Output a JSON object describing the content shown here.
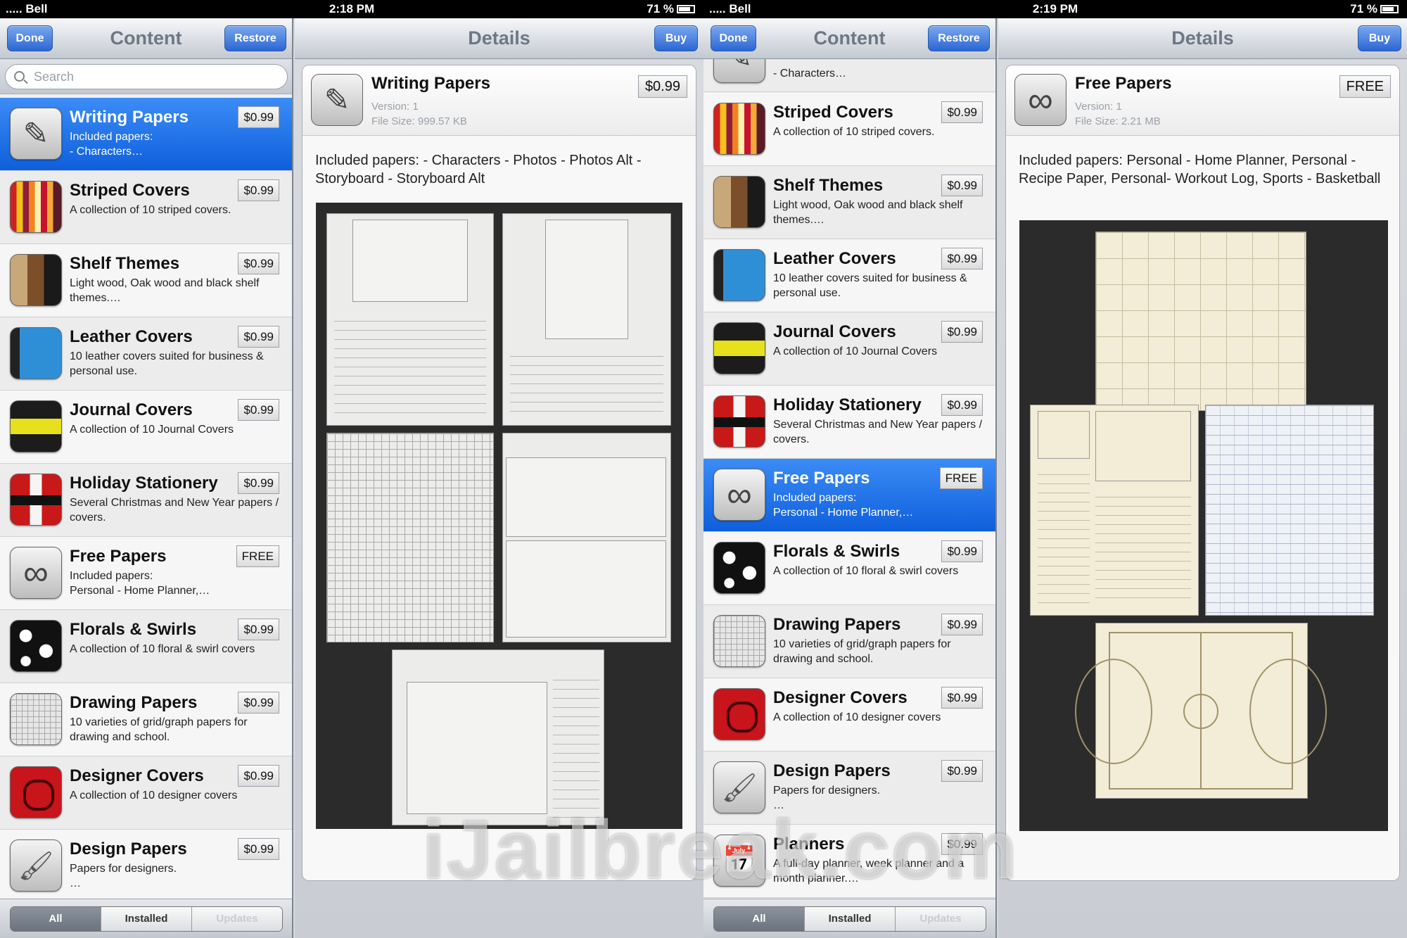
{
  "screen1": {
    "status": {
      "carrier": "..... Bell",
      "time": "2:18 PM",
      "battery": "71 %"
    },
    "left_nav": {
      "title": "Content",
      "done": "Done",
      "restore": "Restore"
    },
    "search_placeholder": "Search",
    "items": [
      {
        "title": "Writing Papers",
        "desc": "Included papers:\n- Characters…",
        "price": "$0.99",
        "icon": "pen-icon",
        "selected": true
      },
      {
        "title": "Striped Covers",
        "desc": "A collection of 10 striped covers.",
        "price": "$0.99",
        "icon": "striped-cover-icon"
      },
      {
        "title": "Shelf Themes",
        "desc": "Light wood, Oak wood and black shelf themes.…",
        "price": "$0.99",
        "icon": "shelf-icon"
      },
      {
        "title": "Leather Covers",
        "desc": "10 leather covers suited for business & personal use.",
        "price": "$0.99",
        "icon": "leather-cover-icon"
      },
      {
        "title": "Journal Covers",
        "desc": "A collection of 10 Journal Covers",
        "price": "$0.99",
        "icon": "journal-cover-icon"
      },
      {
        "title": "Holiday Stationery",
        "desc": "Several Christmas and New Year papers / covers.",
        "price": "$0.99",
        "icon": "holiday-icon"
      },
      {
        "title": "Free Papers",
        "desc": "Included papers:\nPersonal - Home Planner,…",
        "price": "FREE",
        "icon": "infinity-icon"
      },
      {
        "title": "Florals & Swirls",
        "desc": "A collection of 10 floral & swirl covers",
        "price": "$0.99",
        "icon": "floral-icon"
      },
      {
        "title": "Drawing Papers",
        "desc": "10 varieties of grid/graph papers for drawing and school.",
        "price": "$0.99",
        "icon": "grid-paper-icon"
      },
      {
        "title": "Designer Covers",
        "desc": "A collection of 10 designer covers",
        "price": "$0.99",
        "icon": "designer-cover-icon"
      },
      {
        "title": "Design Papers",
        "desc": "Papers for designers.\n…",
        "price": "$0.99",
        "icon": "brush-icon"
      }
    ],
    "segments": [
      "All",
      "Installed",
      "Updates"
    ],
    "right_nav": {
      "title": "Details",
      "buy": "Buy"
    },
    "detail": {
      "title": "Writing Papers",
      "version_label": "Version:   1",
      "size_label": "File Size:  999.57 KB",
      "price": "$0.99",
      "description": "Included papers: - Characters - Photos - Photos Alt - Storyboard - Storyboard Alt"
    }
  },
  "screen2": {
    "status": {
      "carrier": "..... Bell",
      "time": "2:19 PM",
      "battery": "71 %"
    },
    "left_nav": {
      "title": "Content",
      "done": "Done",
      "restore": "Restore"
    },
    "top_partial_desc": "- Characters…",
    "items": [
      {
        "title": "Striped Covers",
        "desc": "A collection of 10 striped covers.",
        "price": "$0.99",
        "icon": "striped-cover-icon"
      },
      {
        "title": "Shelf Themes",
        "desc": "Light wood, Oak wood and black shelf themes.…",
        "price": "$0.99",
        "icon": "shelf-icon"
      },
      {
        "title": "Leather Covers",
        "desc": "10 leather covers suited for business & personal use.",
        "price": "$0.99",
        "icon": "leather-cover-icon"
      },
      {
        "title": "Journal Covers",
        "desc": "A collection of 10 Journal Covers",
        "price": "$0.99",
        "icon": "journal-cover-icon"
      },
      {
        "title": "Holiday Stationery",
        "desc": "Several Christmas and New Year papers / covers.",
        "price": "$0.99",
        "icon": "holiday-icon"
      },
      {
        "title": "Free Papers",
        "desc": "Included papers:\nPersonal - Home Planner,…",
        "price": "FREE",
        "icon": "infinity-icon",
        "selected": true
      },
      {
        "title": "Florals & Swirls",
        "desc": "A collection of 10 floral & swirl covers",
        "price": "$0.99",
        "icon": "floral-icon"
      },
      {
        "title": "Drawing Papers",
        "desc": "10 varieties of grid/graph papers for drawing and school.",
        "price": "$0.99",
        "icon": "grid-paper-icon"
      },
      {
        "title": "Designer Covers",
        "desc": "A collection of 10 designer covers",
        "price": "$0.99",
        "icon": "designer-cover-icon"
      },
      {
        "title": "Design Papers",
        "desc": "Papers for designers.\n…",
        "price": "$0.99",
        "icon": "brush-icon"
      },
      {
        "title": "Planners",
        "desc": "A full-day planner, week planner and a month planner.…",
        "price": "$0.99",
        "icon": "planner-icon"
      }
    ],
    "segments": [
      "All",
      "Installed",
      "Updates"
    ],
    "right_nav": {
      "title": "Details",
      "buy": "Buy"
    },
    "detail": {
      "title": "Free Papers",
      "version_label": "Version:   1",
      "size_label": "File Size:  2.21 MB",
      "price": "FREE",
      "description": "Included papers: Personal - Home Planner, Personal - Recipe Paper, Personal- Workout Log, Sports - Basketball"
    }
  },
  "watermark": "iJailbreak.com"
}
